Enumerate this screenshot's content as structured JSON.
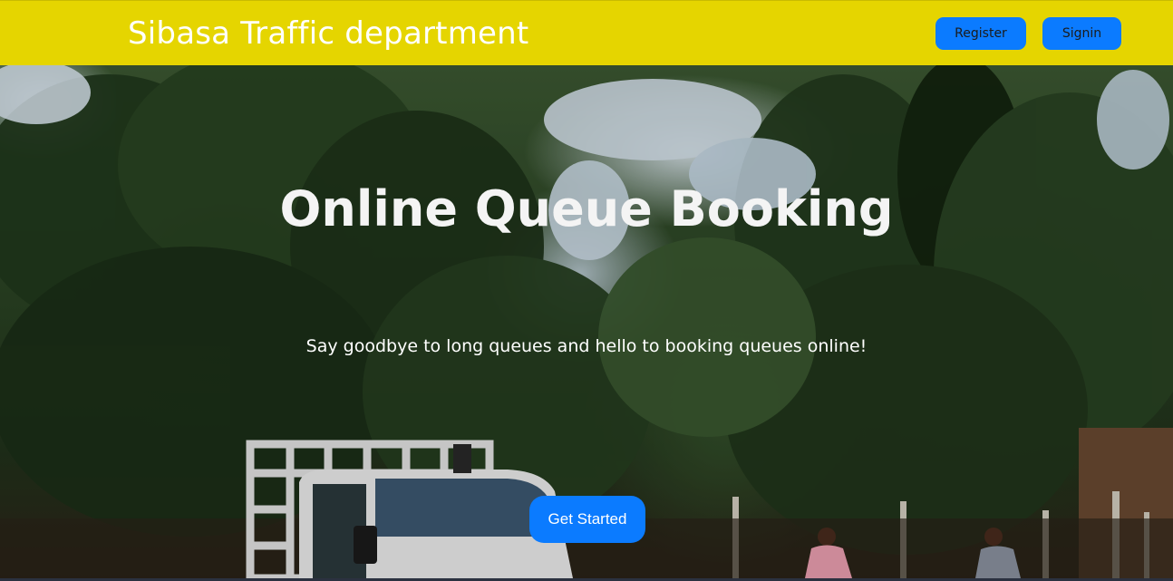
{
  "header": {
    "brand": "Sibasa Traffic department",
    "register_label": "Register",
    "signin_label": "Signin"
  },
  "hero": {
    "title": "Online Queue Booking",
    "subtitle": "Say goodbye to long queues and hello to booking queues online!",
    "cta_label": "Get Started",
    "background": "photo-trees-truck-people"
  },
  "colors": {
    "header_bg": "#e5d500",
    "button_bg": "#0b7bff",
    "button_text": "#1b1b1b",
    "cta_text": "#ffffff",
    "hero_text": "#ffffff"
  }
}
